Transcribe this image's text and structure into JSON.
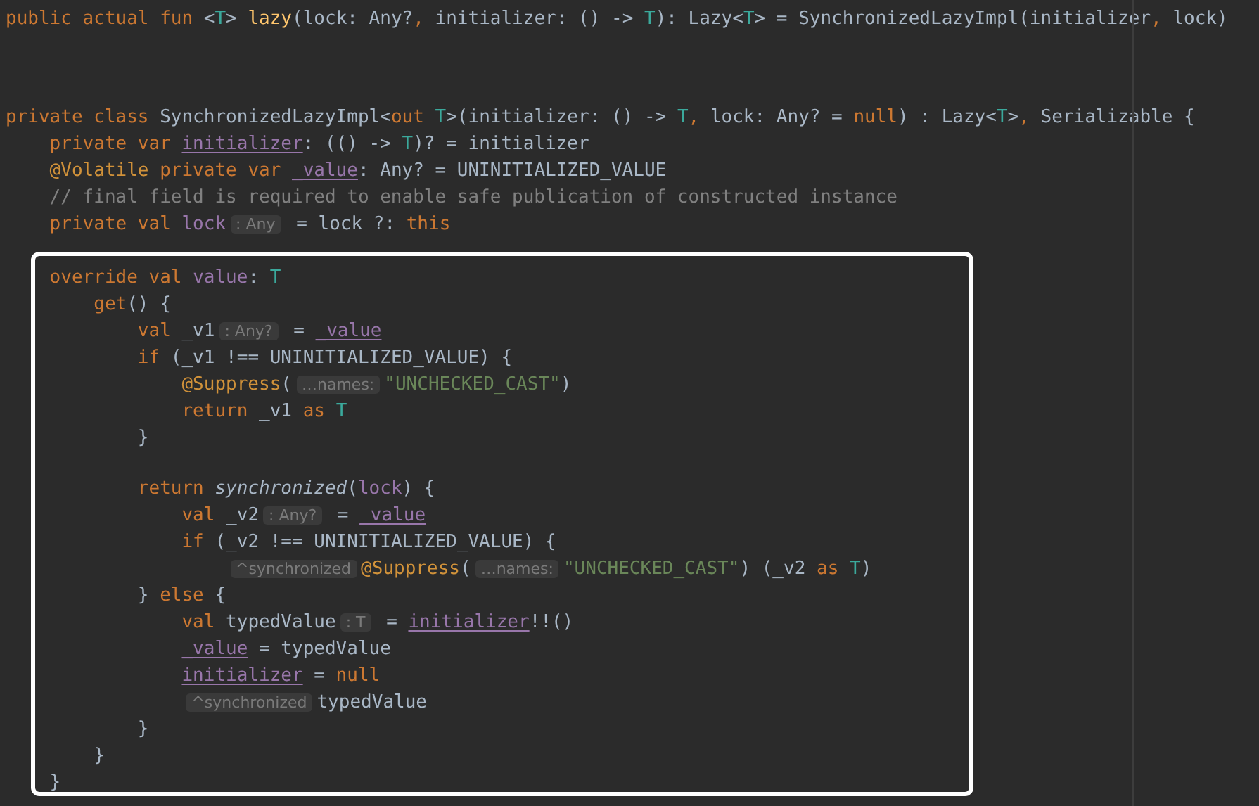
{
  "lines": [
    {
      "kind": "code",
      "tokens": [
        {
          "kind": "kw",
          "text": "public actual fun "
        },
        {
          "kind": "plain",
          "text": "<"
        },
        {
          "kind": "type",
          "text": "T"
        },
        {
          "kind": "plain",
          "text": "> "
        },
        {
          "kind": "fn",
          "text": "lazy"
        },
        {
          "kind": "plain",
          "text": "(lock: Any?"
        },
        {
          "kind": "kw",
          "text": ", "
        },
        {
          "kind": "plain",
          "text": "initializer: () -> "
        },
        {
          "kind": "type",
          "text": "T"
        },
        {
          "kind": "plain",
          "text": "): Lazy<"
        },
        {
          "kind": "type",
          "text": "T"
        },
        {
          "kind": "plain",
          "text": "> = SynchronizedLazyImpl(initializer"
        },
        {
          "kind": "kw",
          "text": ", "
        },
        {
          "kind": "plain",
          "text": "lock)"
        }
      ]
    },
    {
      "kind": "blank"
    },
    {
      "kind": "blank"
    },
    {
      "kind": "blank"
    },
    {
      "kind": "code",
      "tokens": [
        {
          "kind": "kw",
          "text": "private class "
        },
        {
          "kind": "plain",
          "text": "SynchronizedLazyImpl<"
        },
        {
          "kind": "kw",
          "text": "out "
        },
        {
          "kind": "type",
          "text": "T"
        },
        {
          "kind": "plain",
          "text": ">(initializer: () -> "
        },
        {
          "kind": "type",
          "text": "T"
        },
        {
          "kind": "kw",
          "text": ", "
        },
        {
          "kind": "plain",
          "text": "lock: Any? = "
        },
        {
          "kind": "kw",
          "text": "null"
        },
        {
          "kind": "plain",
          "text": ") : Lazy<"
        },
        {
          "kind": "type",
          "text": "T"
        },
        {
          "kind": "plain",
          "text": ">"
        },
        {
          "kind": "kw",
          "text": ", "
        },
        {
          "kind": "plain",
          "text": "Serializable {"
        }
      ]
    },
    {
      "kind": "code",
      "tokens": [
        {
          "kind": "kw",
          "text": "    private var "
        },
        {
          "kind": "propu",
          "text": "initializer"
        },
        {
          "kind": "plain",
          "text": ": (() -> "
        },
        {
          "kind": "type",
          "text": "T"
        },
        {
          "kind": "plain",
          "text": ")? = initializer"
        }
      ]
    },
    {
      "kind": "code",
      "tokens": [
        {
          "kind": "ann",
          "text": "    @Volatile "
        },
        {
          "kind": "kw",
          "text": "private var "
        },
        {
          "kind": "propu",
          "text": "_value"
        },
        {
          "kind": "plain",
          "text": ": Any? = UNINITIALIZED_VALUE"
        }
      ]
    },
    {
      "kind": "code",
      "tokens": [
        {
          "kind": "comment",
          "text": "    // final field is required to enable safe publication of constructed instance"
        }
      ]
    },
    {
      "kind": "code",
      "tokens": [
        {
          "kind": "kw",
          "text": "    private val "
        },
        {
          "kind": "prop",
          "text": "lock"
        },
        {
          "kind": "hint",
          "text": ": Any"
        },
        {
          "kind": "plain",
          "text": " = lock ?: "
        },
        {
          "kind": "kw",
          "text": "this"
        }
      ]
    }
  ],
  "highlighted_lines": [
    {
      "kind": "code",
      "tokens": [
        {
          "kind": "kw",
          "text": "    override val "
        },
        {
          "kind": "prop",
          "text": "value"
        },
        {
          "kind": "plain",
          "text": ": "
        },
        {
          "kind": "type",
          "text": "T"
        }
      ]
    },
    {
      "kind": "code",
      "tokens": [
        {
          "kind": "kw",
          "text": "        get"
        },
        {
          "kind": "plain",
          "text": "() {"
        }
      ]
    },
    {
      "kind": "code",
      "tokens": [
        {
          "kind": "kw",
          "text": "            val "
        },
        {
          "kind": "plain",
          "text": "_v1"
        },
        {
          "kind": "hint",
          "text": ": Any?"
        },
        {
          "kind": "plain",
          "text": " = "
        },
        {
          "kind": "propu",
          "text": "_value"
        }
      ]
    },
    {
      "kind": "code",
      "tokens": [
        {
          "kind": "kw",
          "text": "            if "
        },
        {
          "kind": "plain",
          "text": "(_v1 !== UNINITIALIZED_VALUE) {"
        }
      ]
    },
    {
      "kind": "code",
      "tokens": [
        {
          "kind": "ann",
          "text": "                @Suppress"
        },
        {
          "kind": "plain",
          "text": "("
        },
        {
          "kind": "hint",
          "text": "…names:"
        },
        {
          "kind": "str",
          "text": "\"UNCHECKED_CAST\""
        },
        {
          "kind": "plain",
          "text": ")"
        }
      ]
    },
    {
      "kind": "code",
      "tokens": [
        {
          "kind": "kw",
          "text": "                return "
        },
        {
          "kind": "plain",
          "text": "_v1 "
        },
        {
          "kind": "kw",
          "text": "as "
        },
        {
          "kind": "type",
          "text": "T"
        }
      ]
    },
    {
      "kind": "code",
      "tokens": [
        {
          "kind": "plain",
          "text": "            }"
        }
      ]
    },
    {
      "kind": "blank"
    },
    {
      "kind": "code",
      "tokens": [
        {
          "kind": "kw",
          "text": "            return "
        },
        {
          "kind": "italic",
          "text": "synchronized"
        },
        {
          "kind": "plain",
          "text": "("
        },
        {
          "kind": "prop",
          "text": "lock"
        },
        {
          "kind": "plain",
          "text": ") {"
        }
      ]
    },
    {
      "kind": "code",
      "tokens": [
        {
          "kind": "kw",
          "text": "                val "
        },
        {
          "kind": "plain",
          "text": "_v2"
        },
        {
          "kind": "hint",
          "text": ": Any?"
        },
        {
          "kind": "plain",
          "text": " = "
        },
        {
          "kind": "propu",
          "text": "_value"
        }
      ]
    },
    {
      "kind": "code",
      "tokens": [
        {
          "kind": "kw",
          "text": "                if "
        },
        {
          "kind": "plain",
          "text": "(_v2 !== UNINITIALIZED_VALUE) {"
        }
      ]
    },
    {
      "kind": "code",
      "tokens": [
        {
          "kind": "indent20"
        },
        {
          "kind": "hint",
          "text": "^synchronized"
        },
        {
          "kind": "ann",
          "text": "@Suppress"
        },
        {
          "kind": "plain",
          "text": "("
        },
        {
          "kind": "hint",
          "text": "…names:"
        },
        {
          "kind": "str",
          "text": "\"UNCHECKED_CAST\""
        },
        {
          "kind": "plain",
          "text": ") (_v2 "
        },
        {
          "kind": "kw",
          "text": "as "
        },
        {
          "kind": "type",
          "text": "T"
        },
        {
          "kind": "plain",
          "text": ")"
        }
      ]
    },
    {
      "kind": "code",
      "tokens": [
        {
          "kind": "plain",
          "text": "            } "
        },
        {
          "kind": "kw",
          "text": "else "
        },
        {
          "kind": "plain",
          "text": "{"
        }
      ]
    },
    {
      "kind": "code",
      "tokens": [
        {
          "kind": "kw",
          "text": "                val "
        },
        {
          "kind": "plain",
          "text": "typedValue"
        },
        {
          "kind": "hint",
          "text": ": T"
        },
        {
          "kind": "plain",
          "text": " = "
        },
        {
          "kind": "propu",
          "text": "initializer"
        },
        {
          "kind": "plain",
          "text": "!!()"
        }
      ]
    },
    {
      "kind": "code",
      "tokens": [
        {
          "kind": "indent16"
        },
        {
          "kind": "propu",
          "text": "_value"
        },
        {
          "kind": "plain",
          "text": " = typedValue"
        }
      ]
    },
    {
      "kind": "code",
      "tokens": [
        {
          "kind": "indent16"
        },
        {
          "kind": "propu",
          "text": "initializer"
        },
        {
          "kind": "plain",
          "text": " = "
        },
        {
          "kind": "kw",
          "text": "null"
        }
      ]
    },
    {
      "kind": "code",
      "tokens": [
        {
          "kind": "indent16"
        },
        {
          "kind": "hint",
          "text": "^synchronized"
        },
        {
          "kind": "plain",
          "text": "typedValue"
        }
      ]
    },
    {
      "kind": "code",
      "tokens": [
        {
          "kind": "plain",
          "text": "            }"
        }
      ]
    },
    {
      "kind": "code",
      "tokens": [
        {
          "kind": "plain",
          "text": "        }"
        }
      ]
    },
    {
      "kind": "code",
      "tokens": [
        {
          "kind": "plain",
          "text": "    }"
        }
      ]
    }
  ]
}
